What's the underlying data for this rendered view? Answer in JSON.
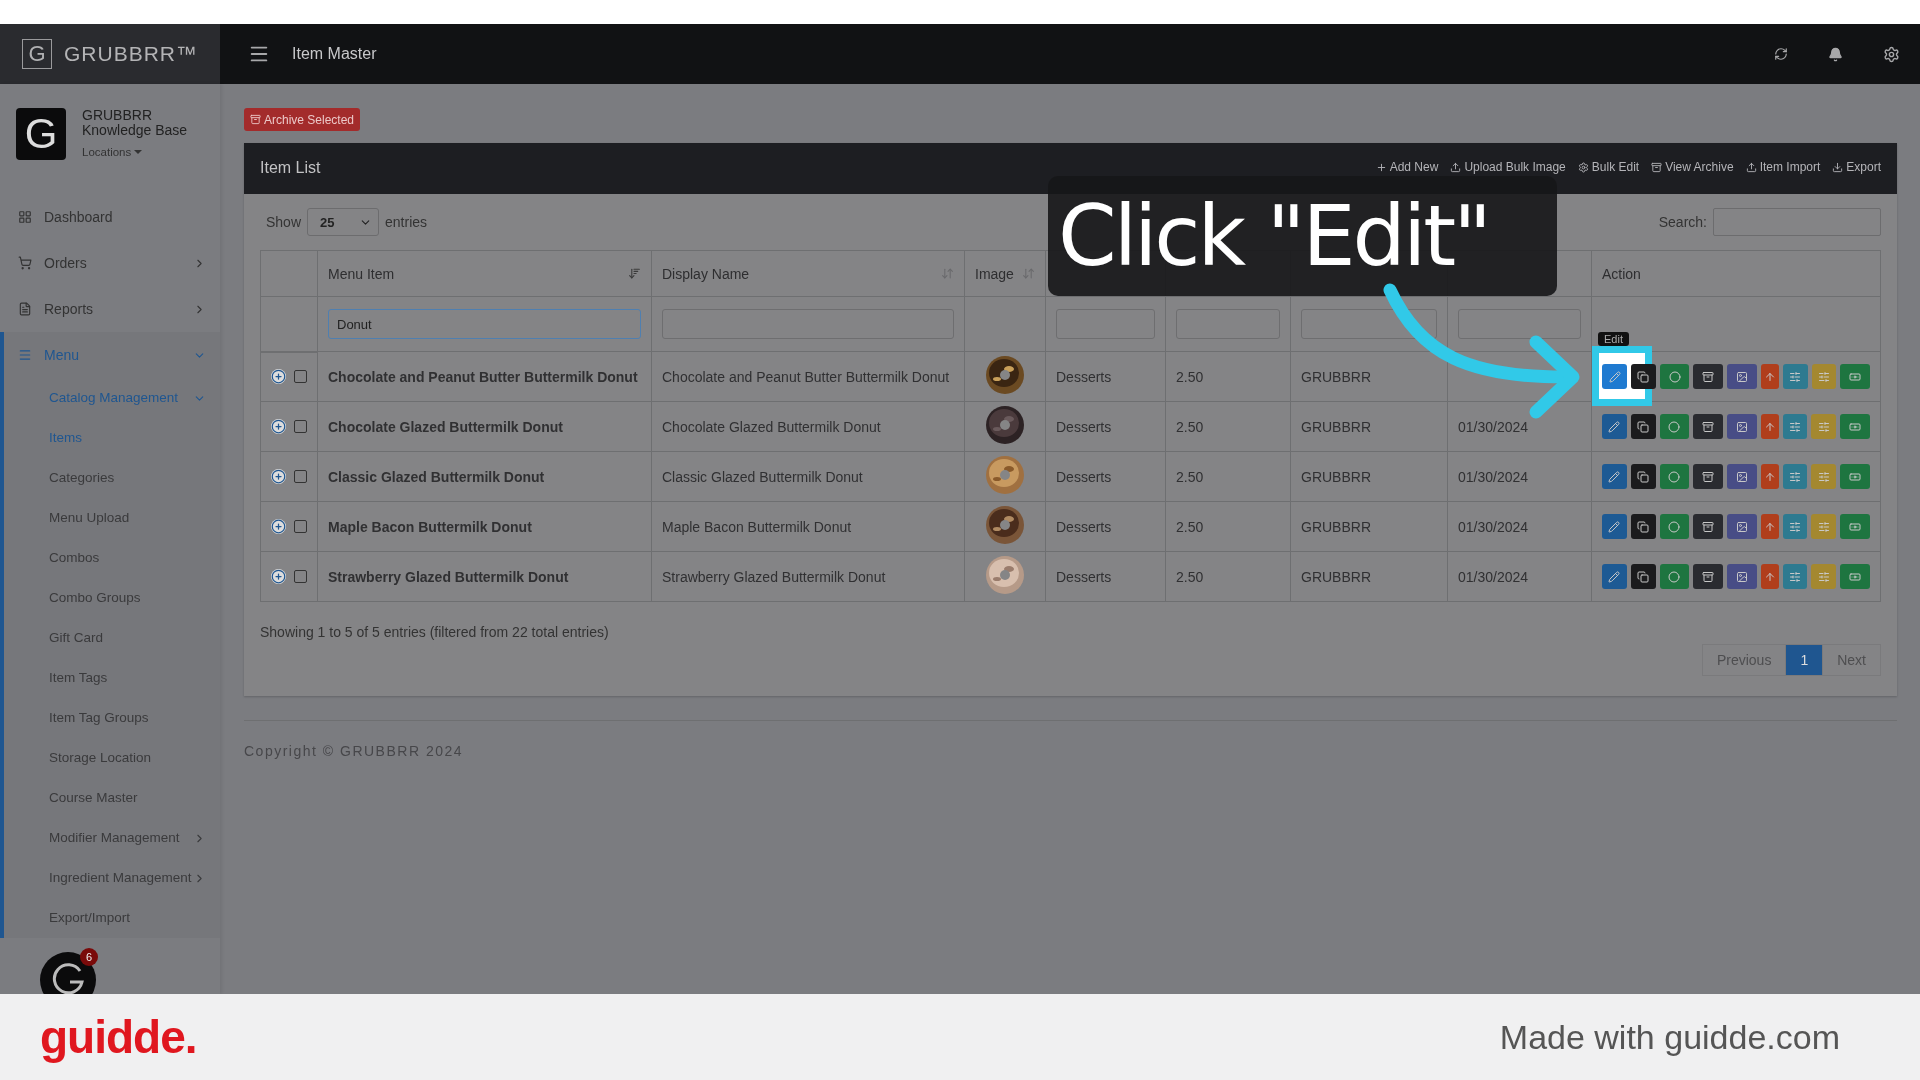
{
  "brand": {
    "logo_letter": "G",
    "name": "GRUBBRR™"
  },
  "header": {
    "title": "Item Master"
  },
  "profile": {
    "avatar_letter": "G",
    "name": "GRUBBRR Knowledge Base",
    "locations": "Locations"
  },
  "sidebar": {
    "items": [
      {
        "label": "Dashboard",
        "selected": false
      },
      {
        "label": "Orders",
        "selected": false,
        "expanded": false
      },
      {
        "label": "Reports",
        "selected": false,
        "expanded": false
      },
      {
        "label": "Menu",
        "selected": true,
        "expanded": true,
        "children": [
          {
            "label": "Catalog Management",
            "selected": true,
            "expanded": true,
            "children": [
              {
                "label": "Items",
                "selected": true
              },
              {
                "label": "Categories",
                "selected": false
              },
              {
                "label": "Menu Upload",
                "selected": false
              },
              {
                "label": "Combos",
                "selected": false
              },
              {
                "label": "Combo Groups",
                "selected": false
              },
              {
                "label": "Gift Card",
                "selected": false
              },
              {
                "label": "Item Tags",
                "selected": false
              },
              {
                "label": "Item Tag Groups",
                "selected": false
              },
              {
                "label": "Storage Location",
                "selected": false
              },
              {
                "label": "Course Master",
                "selected": false
              }
            ]
          },
          {
            "label": "Modifier Management",
            "selected": false,
            "expanded": false
          },
          {
            "label": "Ingredient Management",
            "selected": false,
            "expanded": false
          },
          {
            "label": "Export/Import",
            "selected": false
          }
        ]
      }
    ]
  },
  "archive_button": "Archive Selected",
  "panel": {
    "title": "Item List",
    "toolbar": [
      "Add New",
      "Upload Bulk Image",
      "Bulk Edit",
      "View Archive",
      "Item Import",
      "Export"
    ]
  },
  "length": {
    "label_before": "Show",
    "value": "25",
    "label_after": "entries"
  },
  "search": {
    "label": "Search:"
  },
  "table": {
    "columns": [
      {
        "label": "Menu Item",
        "sorted": true,
        "filterable": true,
        "filter": "Donut"
      },
      {
        "label": "Display Name",
        "sorted": false,
        "filterable": true
      },
      {
        "label": "Image",
        "sorted": false
      },
      {
        "filterable": true
      },
      {
        "filterable": true
      },
      {
        "filterable": true
      },
      {
        "filterable": true
      },
      {
        "label": "Action"
      }
    ],
    "rows": [
      {
        "cells": [
          "Chocolate and Peanut Butter Buttermilk Donut",
          "Chocolate and Peanut Butter Buttermilk Donut",
          {
            "kind": "picture"
          },
          "Desserts",
          "2.50",
          "GRUBBRR",
          null
        ],
        "checked": false,
        "edit_highlighted": true
      },
      {
        "cells": [
          "Chocolate Glazed Buttermilk Donut",
          "Chocolate Glazed Buttermilk Donut",
          {
            "kind": "picture"
          },
          "Desserts",
          "2.50",
          "GRUBBRR",
          "01/30/2024"
        ],
        "checked": false,
        "edit_highlighted": false
      },
      {
        "cells": [
          "Classic Glazed Buttermilk Donut",
          "Classic Glazed Buttermilk Donut",
          {
            "kind": "picture"
          },
          "Desserts",
          "2.50",
          "GRUBBRR",
          "01/30/2024"
        ],
        "checked": false,
        "edit_highlighted": false
      },
      {
        "cells": [
          "Maple Bacon Buttermilk Donut",
          "Maple Bacon Buttermilk Donut",
          {
            "kind": "picture"
          },
          "Desserts",
          "2.50",
          "GRUBBRR",
          "01/30/2024"
        ],
        "checked": false,
        "edit_highlighted": false
      },
      {
        "cells": [
          "Strawberry Glazed Buttermilk Donut",
          "Strawberry Glazed Buttermilk Donut",
          {
            "kind": "picture"
          },
          "Desserts",
          "2.50",
          "GRUBBRR",
          "01/30/2024"
        ],
        "checked": false,
        "edit_highlighted": false
      }
    ]
  },
  "table_info": "Showing 1 to 5 of 5 entries (filtered from 22 total entries)",
  "pagination": [
    {
      "label": "Previous",
      "selected": false,
      "disabled": true
    },
    {
      "label": "1",
      "selected": true,
      "disabled": false
    },
    {
      "label": "Next",
      "selected": false,
      "disabled": true
    }
  ],
  "copyright": "Copyright © GRUBBRR 2024",
  "tooltip": "Edit",
  "callout": "Click \"Edit\"",
  "chat": {
    "badge": "6"
  },
  "footer": {
    "logo": "guidde.",
    "credit": "Made with guidde.com"
  }
}
